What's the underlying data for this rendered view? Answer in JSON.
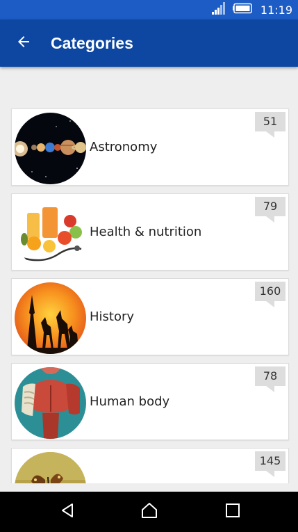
{
  "status_bar": {
    "time": "11:19",
    "signal_icon": "signal-icon",
    "battery_icon": "battery-icon"
  },
  "app_bar": {
    "title": "Categories",
    "back_icon": "arrow-back-icon"
  },
  "categories": [
    {
      "label": "Astronomy",
      "count": "51",
      "icon": "astronomy-planets-image"
    },
    {
      "label": "Health & nutrition",
      "count": "79",
      "icon": "health-fruits-image"
    },
    {
      "label": "History",
      "count": "160",
      "icon": "history-sunset-image"
    },
    {
      "label": "Human body",
      "count": "78",
      "icon": "human-body-anatomy-image"
    },
    {
      "label": "",
      "count": "145",
      "icon": "butterfly-image"
    }
  ],
  "nav_bar": {
    "back_icon": "nav-back-icon",
    "home_icon": "nav-home-icon",
    "recents_icon": "nav-recents-icon"
  },
  "colors": {
    "status_bar": "#1c5cc4",
    "app_bar": "#0d47a1",
    "background": "#eeeeee",
    "card": "#ffffff",
    "badge": "#dddddd"
  }
}
